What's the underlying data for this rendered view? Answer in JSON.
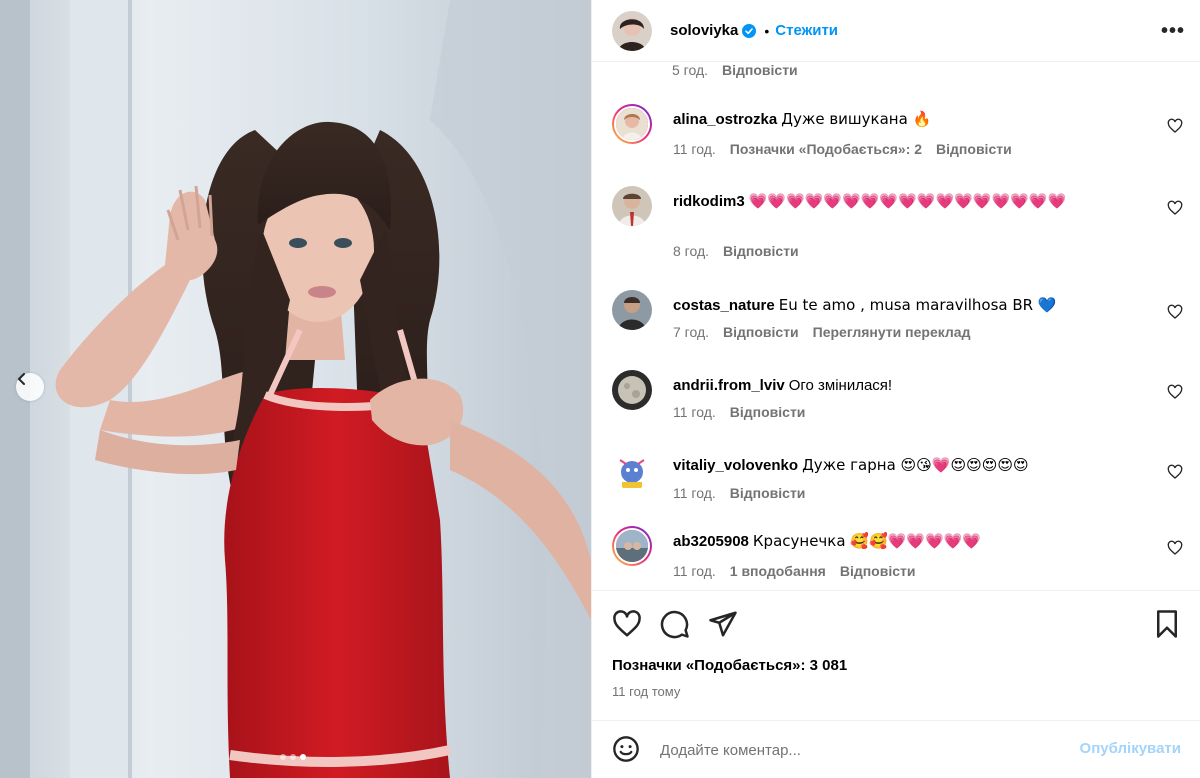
{
  "post": {
    "username": "soloviyka",
    "separator": "•",
    "follow_label": "Стежити",
    "more_label": "•••"
  },
  "partial_comment": {
    "time": "5 год.",
    "reply": "Відповісти"
  },
  "comments": [
    {
      "username": "alina_ostrozka",
      "text": "Дуже вишукана 🔥",
      "time": "11 год.",
      "likes": "Позначки «Подобається»: 2",
      "reply": "Відповісти"
    },
    {
      "username": "ridkodim3",
      "text": "💗💗💗💗💗💗💗💗💗💗💗💗💗💗💗💗💗",
      "time": "8 год.",
      "reply": "Відповісти"
    },
    {
      "username": "costas_nature",
      "text": "Eu te amo , musa maravilhosa BR 💙",
      "time": "7 год.",
      "reply": "Відповісти",
      "translate": "Переглянути переклад"
    },
    {
      "username": "andrii.from_lviv",
      "text": "Ого змінилася!",
      "time": "11 год.",
      "reply": "Відповісти"
    },
    {
      "username": "vitaliy_volovenko",
      "text": "Дуже гарна 😍😘💗😍😍😍😍😍",
      "time": "11 год.",
      "reply": "Відповісти"
    },
    {
      "username": "ab3205908",
      "text": "Красунечка 🥰🥰💗💗💗💗💗",
      "time": "11 год.",
      "likes": "1 вподобання",
      "reply": "Відповісти"
    }
  ],
  "stats": {
    "likes_label": "Позначки «Подобається»: 3 081",
    "time_ago": "11 год тому"
  },
  "composer": {
    "placeholder": "Додайте коментар...",
    "publish_label": "Опублікувати"
  },
  "colors": {
    "accent": "#0095f6",
    "muted": "#737373",
    "dress": "#c8161d",
    "publish_disabled": "#a4d4fa"
  },
  "carousel": {
    "slides": 3,
    "active_slide": 3
  }
}
